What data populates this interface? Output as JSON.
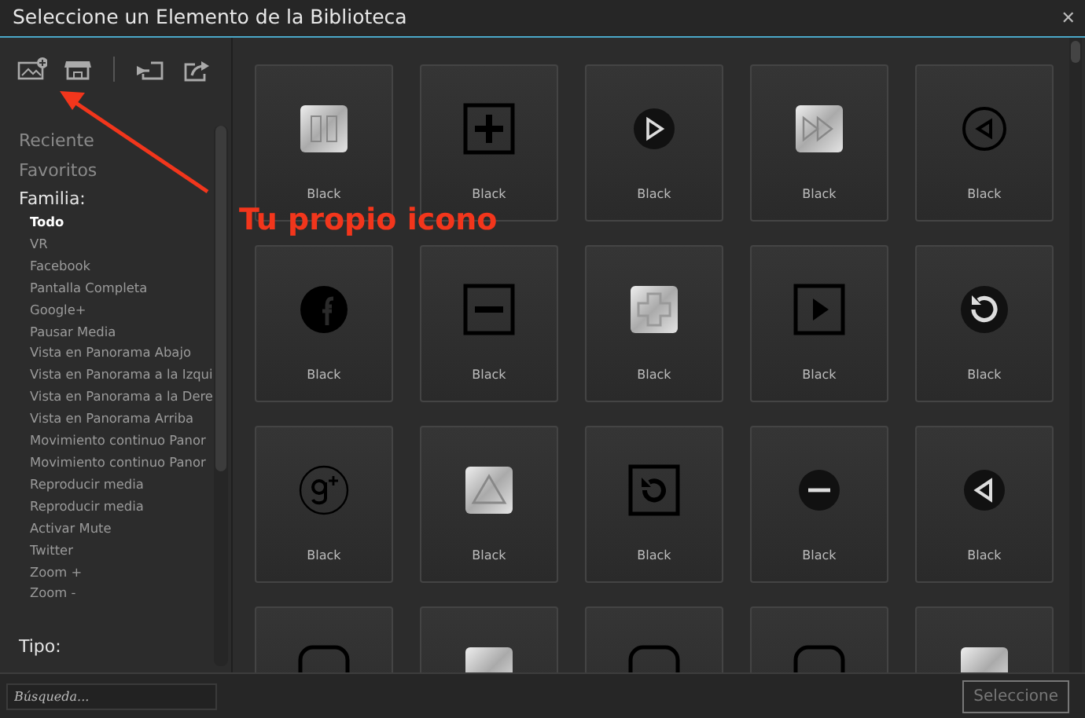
{
  "window": {
    "title": "Seleccione un Elemento de la Biblioteca",
    "close": "✕"
  },
  "toolbar": [
    {
      "kind": "image-add"
    },
    {
      "kind": "store"
    },
    {
      "kind": "divider"
    },
    {
      "kind": "import"
    },
    {
      "kind": "export"
    }
  ],
  "sidebar": {
    "links": [
      "Reciente",
      "Favoritos"
    ],
    "sections": [
      {
        "heading": "Familia:",
        "items": [
          {
            "label": "Todo",
            "selected": true
          },
          {
            "label": "VR",
            "selected": false
          },
          {
            "label": "Facebook",
            "selected": false
          },
          {
            "label": "Pantalla Completa",
            "selected": false
          },
          {
            "label": "Google+",
            "selected": false
          },
          {
            "label": "Pausar Media",
            "selected": false
          },
          {
            "label": "Vista en Panorama Abajo",
            "selected": false
          },
          {
            "label": "Vista en Panorama a la Izqui",
            "selected": false
          },
          {
            "label": "Vista en Panorama a la Dere",
            "selected": false
          },
          {
            "label": "Vista en Panorama Arriba",
            "selected": false
          },
          {
            "label": "Movimiento continuo Panor",
            "selected": false
          },
          {
            "label": "Movimiento continuo Panor",
            "selected": false
          },
          {
            "label": "Reproducir media",
            "selected": false
          },
          {
            "label": "Reproducir media",
            "selected": false
          },
          {
            "label": "Activar Mute",
            "selected": false
          },
          {
            "label": "Twitter",
            "selected": false
          },
          {
            "label": "Zoom +",
            "selected": false
          },
          {
            "label": "Zoom -",
            "selected": false
          }
        ]
      },
      {
        "heading": "Tipo:"
      }
    ]
  },
  "tiles": [
    {
      "kind": "metal-pause",
      "label": "Black"
    },
    {
      "kind": "square-plus",
      "label": "Black"
    },
    {
      "kind": "dark-circle-play",
      "label": "Black"
    },
    {
      "kind": "metal-forward",
      "label": "Black"
    },
    {
      "kind": "ring-left",
      "label": "Black"
    },
    {
      "kind": "circle-f",
      "label": "Black"
    },
    {
      "kind": "square-minus",
      "label": "Black"
    },
    {
      "kind": "metal-cross",
      "label": "Black"
    },
    {
      "kind": "square-play",
      "label": "Black"
    },
    {
      "kind": "dark-circle-reload",
      "label": "Black"
    },
    {
      "kind": "ring-g",
      "label": "Black"
    },
    {
      "kind": "metal-triangle",
      "label": "Black"
    },
    {
      "kind": "square-reload",
      "label": "Black"
    },
    {
      "kind": "dark-circle-minus",
      "label": "Black"
    },
    {
      "kind": "dark-circle-left",
      "label": "Black"
    },
    {
      "kind": "rounded-outline"
    },
    {
      "kind": "metal-plain"
    },
    {
      "kind": "rounded-outline"
    },
    {
      "kind": "rounded-outline"
    },
    {
      "kind": "metal-plain"
    }
  ],
  "search": {
    "placeholder": "Búsqueda..."
  },
  "select_button": {
    "label": "Seleccione",
    "disabled": true
  },
  "annotation": {
    "text": "Tu propio icono"
  }
}
